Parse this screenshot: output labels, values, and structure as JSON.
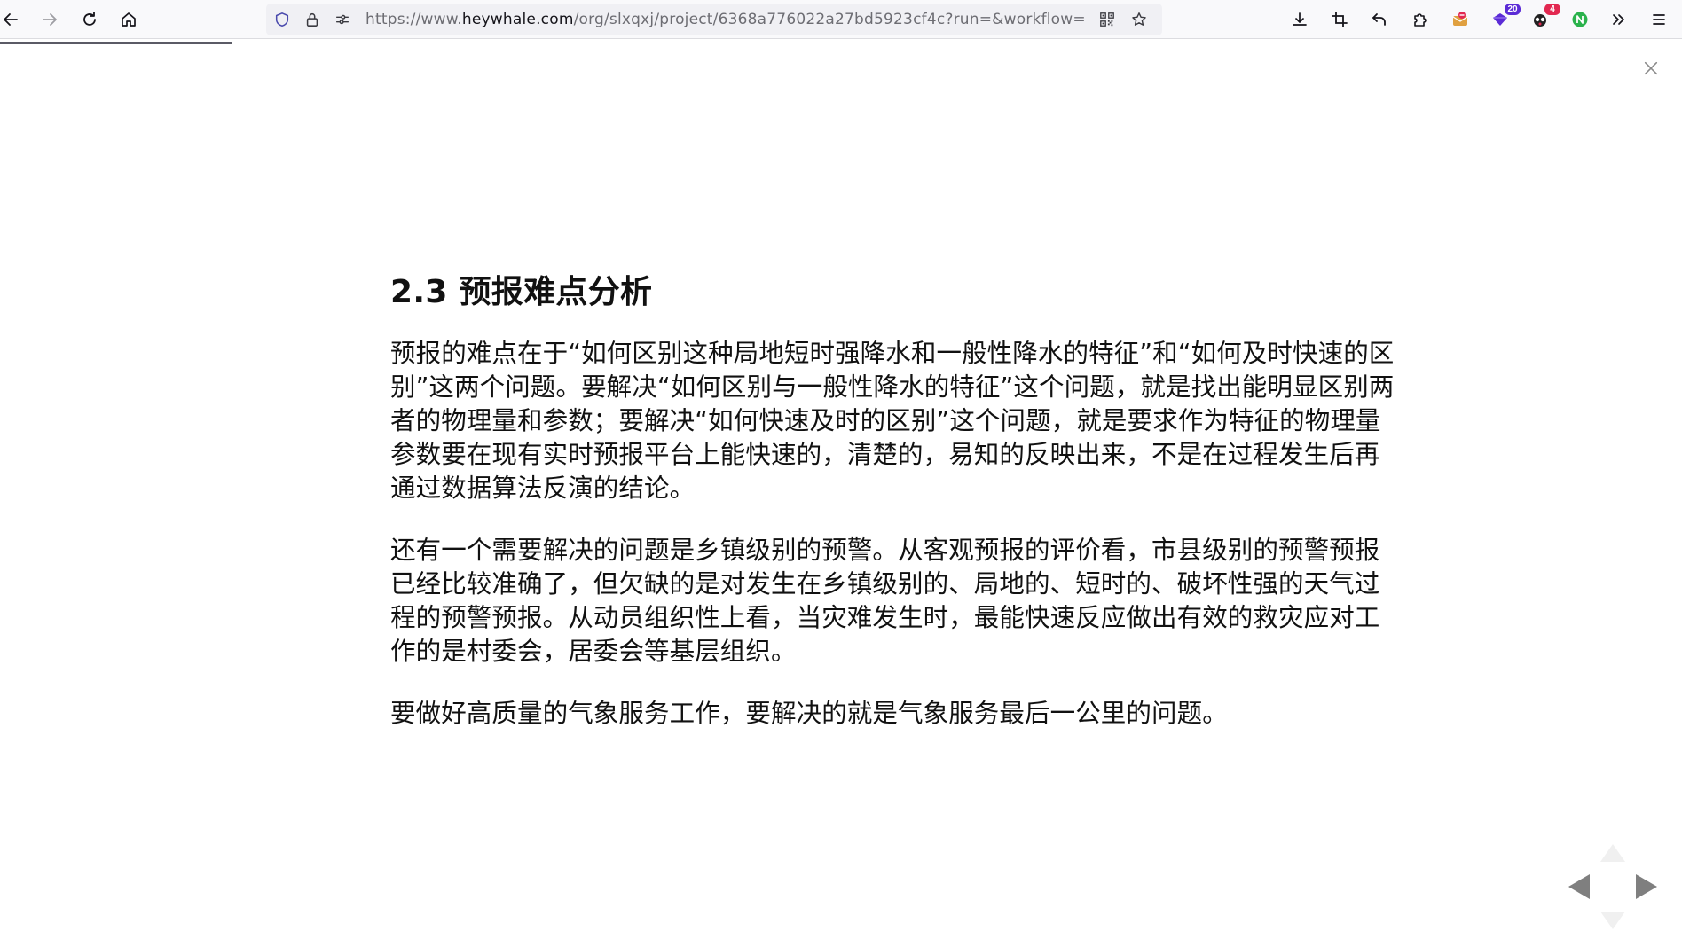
{
  "browser": {
    "url_prefix": "https://www.",
    "url_host": "heywhale.com",
    "url_path": "/org/slxqxj/project/6368a776022a27bd5923cf4c?run=&workflow=",
    "extension_badges": [
      "20",
      "4"
    ],
    "colors": {
      "toolbar_bg": "#f9f9fb",
      "urlbar_bg": "#f0f0f4",
      "badge_purple": "#5b2bd6",
      "badge_red": "#e22850",
      "ext_green": "#2bb24c"
    }
  },
  "slide": {
    "heading": "2.3 预报难点分析",
    "paragraphs": [
      "预报的难点在于“如何区别这种局地短时强降水和一般性降水的特征”和“如何及时快速的区别”这两个问题。要解决“如何区别与一般性降水的特征”这个问题，就是找出能明显区别两者的物理量和参数；要解决“如何快速及时的区别”这个问题，就是要求作为特征的物理量参数要在现有实时预报平台上能快速的，清楚的，易知的反映出来，不是在过程发生后再通过数据算法反演的结论。",
      "还有一个需要解决的问题是乡镇级别的预警。从客观预报的评价看，市县级别的预警预报已经比较准确了，但欠缺的是对发生在乡镇级别的、局地的、短时的、破坏性强的天气过程的预警预报。从动员组织性上看，当灾难发生时，最能快速反应做出有效的救灾应对工作的是村委会，居委会等基层组织。",
      "要做好高质量的气象服务工作，要解决的就是气象服务最后一公里的问题。"
    ]
  },
  "icons": {
    "back": "arrow-left-icon",
    "forward": "arrow-right-icon",
    "reload": "reload-icon",
    "home": "home-icon",
    "shield": "tracking-protection-shield-icon",
    "lock": "lock-icon",
    "permissions": "site-permissions-icon",
    "qr": "qr-code-icon",
    "bookmark": "star-bookmark-icon",
    "downloads": "download-icon",
    "crop": "screenshot-crop-icon",
    "undo": "undo-arrow-icon",
    "extensions": "puzzle-extensions-icon",
    "overflow": "chevrons-overflow-icon",
    "menu": "hamburger-menu-icon",
    "close": "close-icon",
    "nav_prev": "triangle-left-icon",
    "nav_next": "triangle-right-icon",
    "nav_up": "triangle-up-icon",
    "nav_down": "triangle-down-icon"
  }
}
